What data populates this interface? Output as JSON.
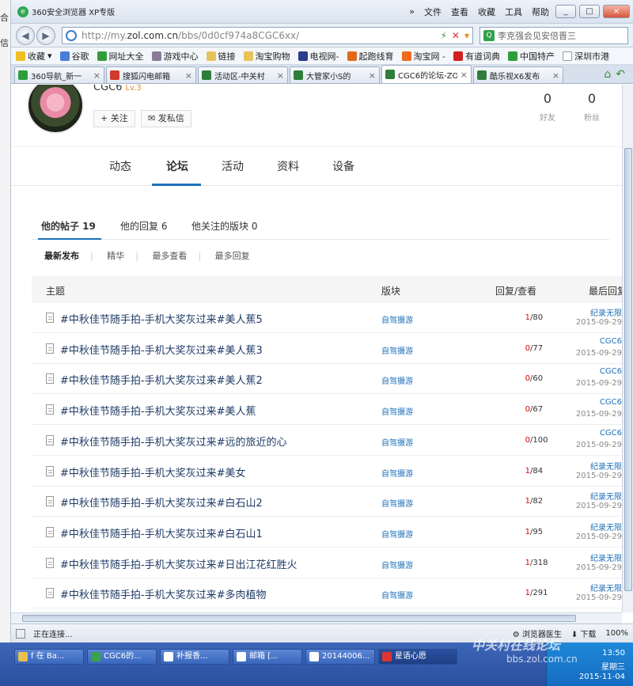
{
  "window": {
    "title": "360安全浏览器 XP专版",
    "menu": [
      "文件",
      "查看",
      "收藏",
      "工具",
      "帮助"
    ],
    "controls": [
      "_",
      "□",
      "×"
    ]
  },
  "address": {
    "url_prefix": "http://my.",
    "url_host": "zol.com.cn",
    "url_path": "/bbs/0d0cf974a8CGC6xx/",
    "search_placeholder": "李克强会见安倍晋三"
  },
  "bookmarks": [
    "收藏",
    "谷歌",
    "网址大全",
    "游戏中心",
    "链接",
    "淘宝购物",
    "电视网-",
    "起跑线育",
    "淘宝网 -",
    "有道词典",
    "中国特产",
    "深圳市港"
  ],
  "tabs": [
    {
      "label": "360导航_新一",
      "color": "#2f9e3a"
    },
    {
      "label": "搜狐闪电邮箱",
      "color": "#d03b2b"
    },
    {
      "label": "活动区-中关村",
      "color": "#2f7d3a"
    },
    {
      "label": "大管家小S的",
      "color": "#2f7d3a"
    },
    {
      "label": "CGC6的论坛-ZO",
      "color": "#2f7d3a"
    },
    {
      "label": "酷乐视X6发布",
      "color": "#2f7d3a"
    }
  ],
  "left_strip": [
    "合",
    "信"
  ],
  "profile": {
    "username": "CGC6",
    "level": "Lv.3",
    "follow_label": "+ 关注",
    "message_label": "发私信",
    "friends_count": "0",
    "friends_label": "好友",
    "fans_count": "0",
    "fans_label": "粉丝"
  },
  "nav": [
    "动态",
    "论坛",
    "活动",
    "资料",
    "设备"
  ],
  "subtabs": [
    "他的帖子 19",
    "他的回复 6",
    "他关注的版块 0"
  ],
  "filters": [
    "最新发布",
    "精华",
    "最多查看",
    "最多回复"
  ],
  "table": {
    "headers": {
      "topic": "主题",
      "board": "版块",
      "reply_view": "回复/查看",
      "last_reply": "最后回复"
    },
    "rows": [
      {
        "title": "#中秋佳节随手拍-手机大奖灰过来#美人蕉5",
        "board": "自驾摄游",
        "replies": "1",
        "views": "/80",
        "user": "纪录无限",
        "date": "2015-09-29"
      },
      {
        "title": "#中秋佳节随手拍-手机大奖灰过来#美人蕉3",
        "board": "自驾摄游",
        "replies": "0",
        "views": "/77",
        "user": "CGC6",
        "date": "2015-09-29"
      },
      {
        "title": "#中秋佳节随手拍-手机大奖灰过来#美人蕉2",
        "board": "自驾摄游",
        "replies": "0",
        "views": "/60",
        "user": "CGC6",
        "date": "2015-09-29"
      },
      {
        "title": "#中秋佳节随手拍-手机大奖灰过来#美人蕉",
        "board": "自驾摄游",
        "replies": "0",
        "views": "/67",
        "user": "CGC6",
        "date": "2015-09-29"
      },
      {
        "title": "#中秋佳节随手拍-手机大奖灰过来#远的旅近的心",
        "board": "自驾摄游",
        "replies": "0",
        "views": "/100",
        "user": "CGC6",
        "date": "2015-09-29"
      },
      {
        "title": "#中秋佳节随手拍-手机大奖灰过来#美女",
        "board": "自驾摄游",
        "replies": "1",
        "views": "/84",
        "user": "纪录无限",
        "date": "2015-09-29"
      },
      {
        "title": "#中秋佳节随手拍-手机大奖灰过来#白石山2",
        "board": "自驾摄游",
        "replies": "1",
        "views": "/82",
        "user": "纪录无限",
        "date": "2015-09-29"
      },
      {
        "title": "#中秋佳节随手拍-手机大奖灰过来#白石山1",
        "board": "自驾摄游",
        "replies": "1",
        "views": "/95",
        "user": "纪录无限",
        "date": "2015-09-29"
      },
      {
        "title": "#中秋佳节随手拍-手机大奖灰过来#日出江花红胜火",
        "board": "自驾摄游",
        "replies": "1",
        "views": "/318",
        "user": "纪录无限",
        "date": "2015-09-29"
      },
      {
        "title": "#中秋佳节随手拍-手机大奖灰过来#多肉植物",
        "board": "自驾摄游",
        "replies": "1",
        "views": "/291",
        "user": "纪录无限",
        "date": "2015-09-29"
      }
    ]
  },
  "status": {
    "text": "正在连接...",
    "doctor": "浏览器医生",
    "download": "下载",
    "zoom": "100%"
  },
  "taskbar": {
    "tasks": [
      "f 在 Ba...",
      "CGC6的...",
      "补报香...",
      "邮箱 [...",
      "20144006...",
      "星语心愿"
    ],
    "time": "13:50",
    "day": "星期三",
    "date": "2015-11-04"
  },
  "watermark": {
    "name": "中关村在线论坛",
    "url": "bbs.zol.com.cn"
  }
}
